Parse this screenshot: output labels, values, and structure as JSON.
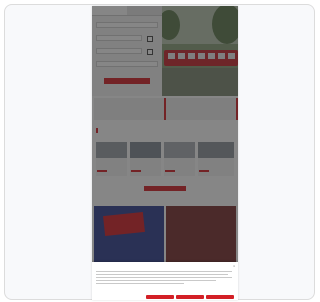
{
  "booking": {
    "tabs": [
      "",
      ""
    ],
    "fields": [
      {
        "label": "",
        "value": ""
      },
      {
        "label": "",
        "value": ""
      },
      {
        "label": "",
        "value": ""
      },
      {
        "label": "",
        "value": ""
      }
    ],
    "cta": ""
  },
  "panels": [
    {
      "title": "",
      "subtitle": ""
    },
    {
      "title": "",
      "subtitle": ""
    }
  ],
  "section": {
    "title": "",
    "subtitle": ""
  },
  "cards": [
    {
      "title": ""
    },
    {
      "title": ""
    },
    {
      "title": ""
    },
    {
      "title": ""
    }
  ],
  "more_button": "",
  "promos": [
    {
      "sign": "",
      "caption": ""
    },
    {
      "sign": "",
      "caption": ""
    }
  ],
  "cookie": {
    "title": "",
    "options_text": "",
    "link_text": "",
    "buttons": [
      "",
      "",
      ""
    ]
  },
  "colors": {
    "brand": "#d31f26"
  }
}
